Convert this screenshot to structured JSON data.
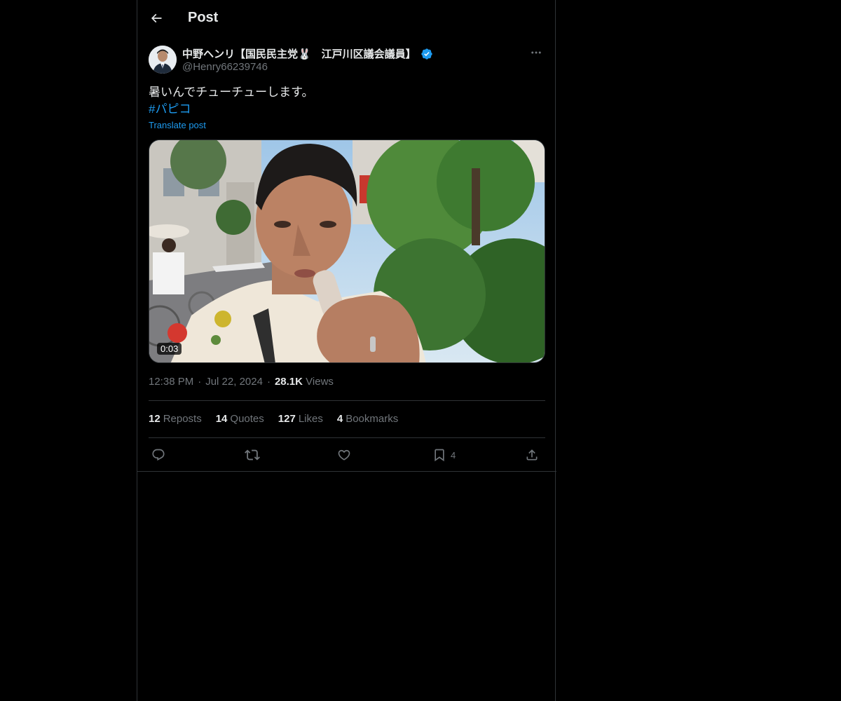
{
  "header": {
    "title": "Post",
    "back_icon": "arrow-left-icon"
  },
  "post": {
    "author_name": "中野ヘンリ【国民民主党🐰　江戸川区議会議員】",
    "author_handle": "@Henry66239746",
    "verified": true,
    "text_line1": "暑いんでチューチューします。",
    "hashtag": "#パピコ",
    "translate_label": "Translate post",
    "video_duration": "0:03",
    "time": "12:38 PM",
    "date": "Jul 22, 2024",
    "views_count": "28.1K",
    "views_label": "Views"
  },
  "stats": {
    "reposts_count": "12",
    "reposts_label": "Reposts",
    "quotes_count": "14",
    "quotes_label": "Quotes",
    "likes_count": "127",
    "likes_label": "Likes",
    "bookmarks_count": "4",
    "bookmarks_label": "Bookmarks"
  },
  "actions": {
    "reply_icon": "reply-icon",
    "repost_icon": "repost-icon",
    "like_icon": "heart-icon",
    "bookmark_icon": "bookmark-icon",
    "bookmark_count": "4",
    "share_icon": "share-icon"
  },
  "colors": {
    "background": "#000000",
    "text_primary": "#e7e9ea",
    "text_secondary": "#71767b",
    "accent": "#1d9bf0",
    "border": "#2f3336"
  }
}
